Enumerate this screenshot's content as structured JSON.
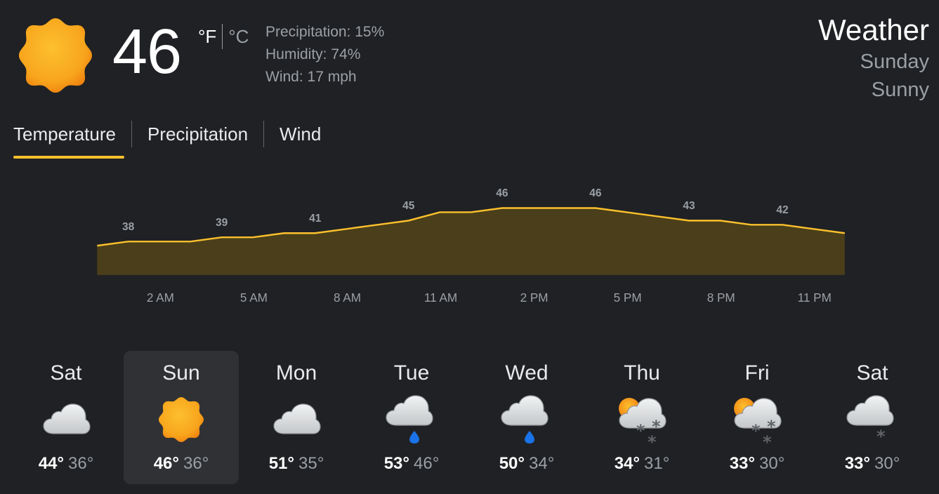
{
  "current": {
    "icon": "sunny-icon",
    "temperature": "46",
    "unit_f": "°F",
    "unit_c": "°C",
    "precipitation": "Precipitation: 15%",
    "humidity": "Humidity: 74%",
    "wind": "Wind: 17 mph"
  },
  "header": {
    "title": "Weather",
    "day": "Sunday",
    "condition": "Sunny"
  },
  "tabs": [
    {
      "label": "Temperature",
      "selected": true
    },
    {
      "label": "Precipitation",
      "selected": false
    },
    {
      "label": "Wind",
      "selected": false
    }
  ],
  "colors": {
    "accent": "#fbc02d",
    "area_fill": "#4a3f1a",
    "background": "#202124",
    "selected_day": "#303134",
    "sun_core": "#fbb224",
    "rain": "#1a73e8"
  },
  "chart_data": {
    "type": "area",
    "x": [
      "2 AM",
      "5 AM",
      "8 AM",
      "11 AM",
      "2 PM",
      "5 PM",
      "8 PM",
      "11 PM"
    ],
    "values": [
      38,
      39,
      41,
      45,
      46,
      46,
      43,
      42
    ],
    "labeled_values": [
      "38",
      "39",
      "41",
      "45",
      "46",
      "46",
      "43",
      "42"
    ],
    "x_tick_labels": [
      "2 AM",
      "5 AM",
      "8 AM",
      "11 AM",
      "2 PM",
      "5 PM",
      "8 PM",
      "11 PM"
    ],
    "hourly_profile": [
      37,
      38,
      38,
      38,
      39,
      39,
      40,
      40,
      41,
      42,
      43,
      45,
      45,
      46,
      46,
      46,
      46,
      45,
      44,
      43,
      43,
      42,
      42,
      41,
      40
    ],
    "ylim": [
      30,
      50
    ],
    "grid": false,
    "title": "",
    "xlabel": "",
    "ylabel": ""
  },
  "forecast": [
    {
      "day": "Sat",
      "icon": "cloudy-icon",
      "high": "44°",
      "low": "36°",
      "selected": false
    },
    {
      "day": "Sun",
      "icon": "sunny-icon",
      "high": "46°",
      "low": "36°",
      "selected": true
    },
    {
      "day": "Mon",
      "icon": "cloudy-icon",
      "high": "51°",
      "low": "35°",
      "selected": false
    },
    {
      "day": "Tue",
      "icon": "rain-icon",
      "high": "53°",
      "low": "46°",
      "selected": false
    },
    {
      "day": "Wed",
      "icon": "rain-icon",
      "high": "50°",
      "low": "34°",
      "selected": false
    },
    {
      "day": "Thu",
      "icon": "partly-cloudy-snow-icon",
      "high": "34°",
      "low": "31°",
      "selected": false
    },
    {
      "day": "Fri",
      "icon": "partly-cloudy-snow-icon",
      "high": "33°",
      "low": "30°",
      "selected": false
    },
    {
      "day": "Sat",
      "icon": "snow-icon",
      "high": "33°",
      "low": "30°",
      "selected": false
    }
  ]
}
